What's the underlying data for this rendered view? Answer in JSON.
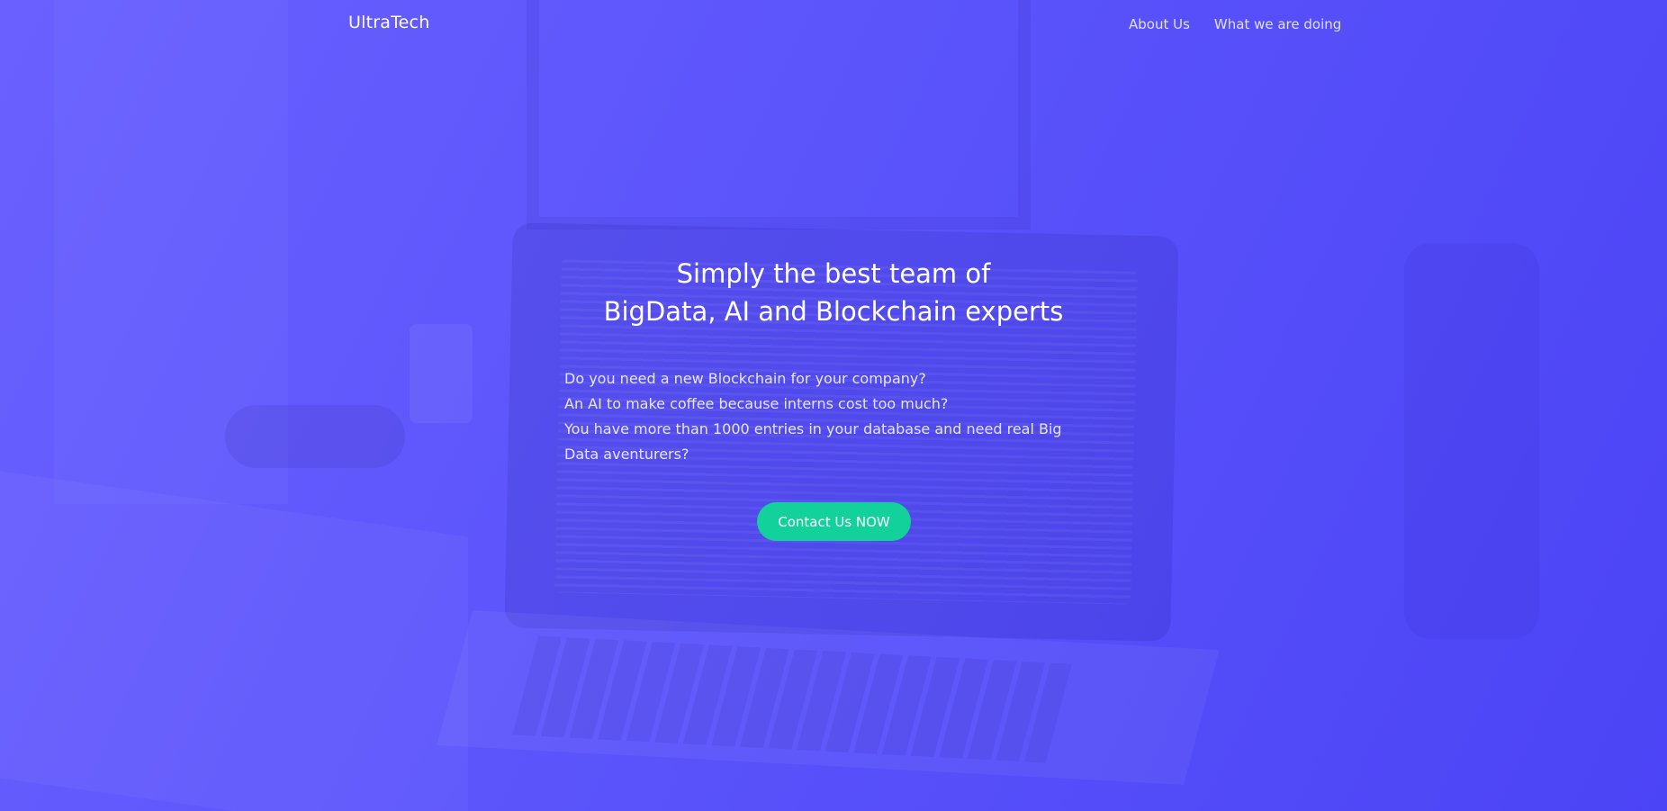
{
  "nav": {
    "brand": "UltraTech",
    "links": [
      "About Us",
      "What we are doing"
    ]
  },
  "hero": {
    "headline_line1": "Simply the best team of",
    "headline_line2": "BigData, AI and Blockchain experts",
    "pitch_lines": [
      "Do you need a new Blockchain for your company?",
      "An AI to make coffee because interns cost too much?",
      "You have more than 1000 entries in your database and need real Big Data aventurers?"
    ],
    "cta_label": "Contact Us NOW"
  },
  "colors": {
    "background": "#5b54fb",
    "cta": "#13d19b",
    "text": "#ffffff"
  }
}
